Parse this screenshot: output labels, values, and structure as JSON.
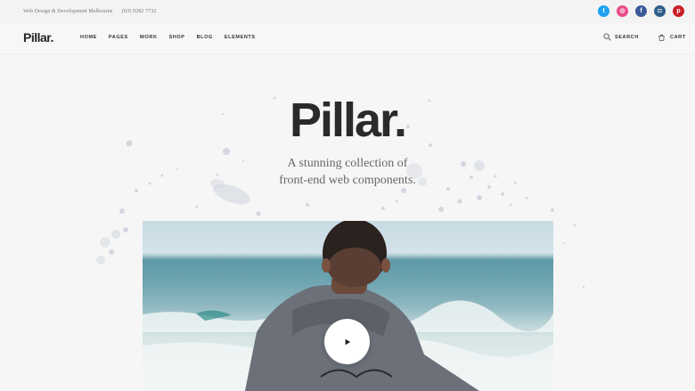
{
  "topbar": {
    "tagline": "Web Design & Development Melbourne",
    "phone": "(03) 9282 7732",
    "socials": [
      {
        "name": "twitter-icon",
        "glyph": "t",
        "color": "#1da1f2"
      },
      {
        "name": "dribbble-icon",
        "glyph": "◎",
        "color": "#ea4c89"
      },
      {
        "name": "facebook-icon",
        "glyph": "f",
        "color": "#3b5998"
      },
      {
        "name": "instagram-icon",
        "glyph": "◘",
        "color": "#2f5f8a"
      },
      {
        "name": "pinterest-icon",
        "glyph": "p",
        "color": "#cb2027"
      }
    ]
  },
  "nav": {
    "logo": "Pillar.",
    "menu": [
      "HOME",
      "PAGES",
      "WORK",
      "SHOP",
      "BLOG",
      "ELEMENTS"
    ],
    "search_label": "SEARCH",
    "cart_label": "CART"
  },
  "hero": {
    "title": "Pillar.",
    "subtitle_line1": "A stunning collection of",
    "subtitle_line2": "front-end web components."
  },
  "video": {
    "play_icon": "play-icon"
  }
}
